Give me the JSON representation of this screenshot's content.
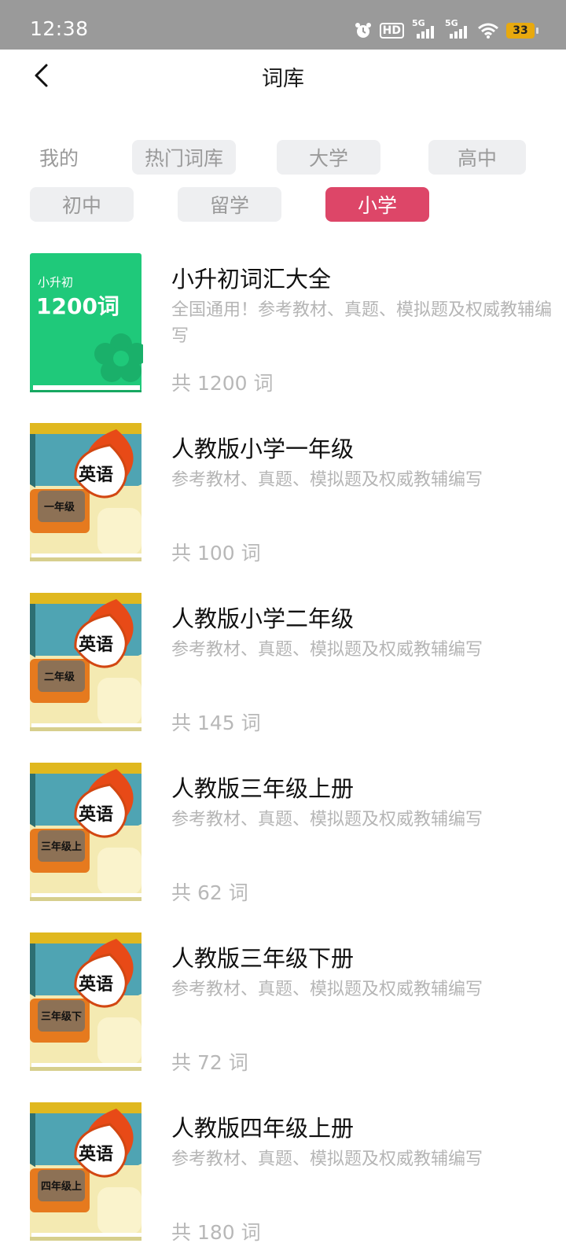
{
  "status_bar": {
    "time": "12:38",
    "hd_label": "HD",
    "network_1": "5G",
    "network_2": "5G",
    "battery": "33"
  },
  "header": {
    "title": "词库",
    "back_icon": "chevron-left-icon"
  },
  "tabs": [
    {
      "label": "我的",
      "active": false
    },
    {
      "label": "热门词库",
      "active": false
    },
    {
      "label": "大学",
      "active": false
    },
    {
      "label": "高中",
      "active": false
    },
    {
      "label": "初中",
      "active": false
    },
    {
      "label": "留学",
      "active": false
    },
    {
      "label": "小学",
      "active": true
    }
  ],
  "colors": {
    "active_tab": "#dd4668",
    "green_cover": "#1fc97a",
    "english_cover_teal": "#4fa4b3",
    "english_cover_yellow": "#f4eab2"
  },
  "books": [
    {
      "title": "小升初词汇大全",
      "description": "全国通用！参考教材、真题、模拟题及权威教辅编写",
      "count": "共 1200 词",
      "cover": {
        "style": "green",
        "small": "小升初",
        "big": "1200词"
      }
    },
    {
      "title": "人教版小学一年级",
      "description": "参考教材、真题、模拟题及权威教辅编写",
      "count": "共 100 词",
      "cover": {
        "style": "english",
        "badge": "英语",
        "grade": "一年级"
      }
    },
    {
      "title": "人教版小学二年级",
      "description": "参考教材、真题、模拟题及权威教辅编写",
      "count": "共 145 词",
      "cover": {
        "style": "english",
        "badge": "英语",
        "grade": "二年级"
      }
    },
    {
      "title": "人教版三年级上册",
      "description": "参考教材、真题、模拟题及权威教辅编写",
      "count": "共 62 词",
      "cover": {
        "style": "english",
        "badge": "英语",
        "grade": "三年级上"
      }
    },
    {
      "title": "人教版三年级下册",
      "description": "参考教材、真题、模拟题及权威教辅编写",
      "count": "共 72 词",
      "cover": {
        "style": "english",
        "badge": "英语",
        "grade": "三年级下"
      }
    },
    {
      "title": "人教版四年级上册",
      "description": "参考教材、真题、模拟题及权威教辅编写",
      "count": "共 180 词",
      "cover": {
        "style": "english",
        "badge": "英语",
        "grade": "四年级上"
      }
    }
  ]
}
